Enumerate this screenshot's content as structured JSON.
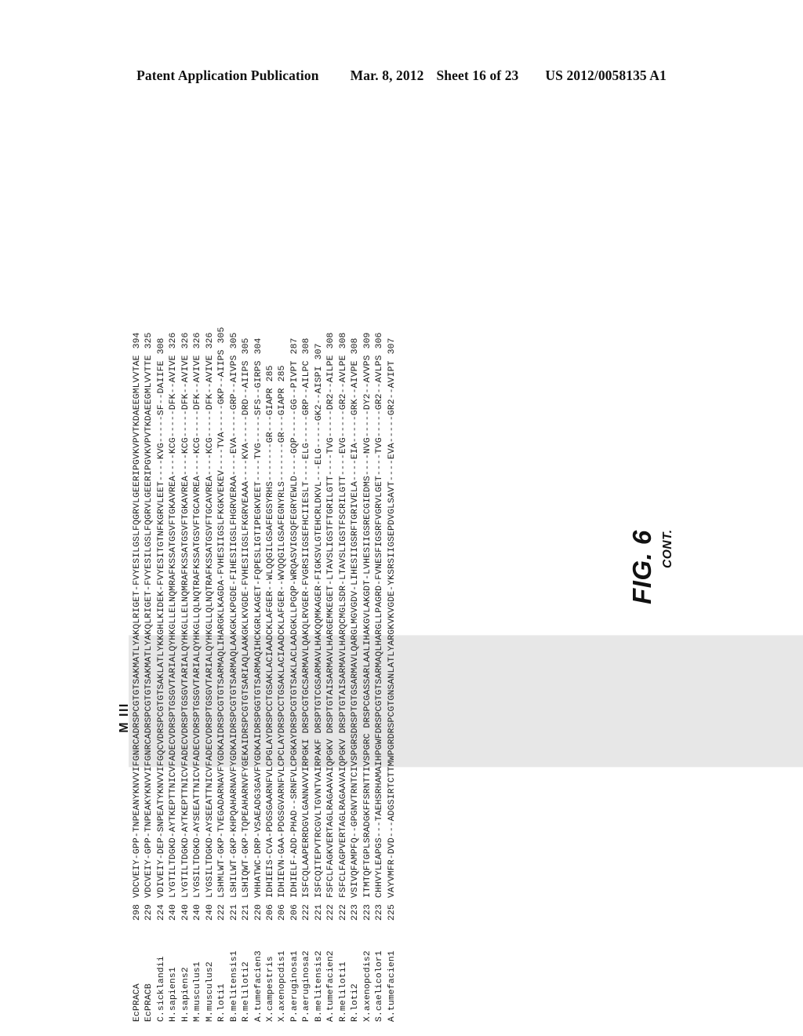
{
  "header": {
    "publication": "Patent Application Publication",
    "date": "Mar. 8, 2012",
    "sheet": "Sheet 16 of 23",
    "patent_number": "US 2012/0058135 A1"
  },
  "figure": {
    "caption_main": "FIG. 6",
    "caption_cont": "CONT.",
    "motif_label": "M III"
  },
  "alignment": {
    "rows": [
      {
        "name": "EcPRACA",
        "start": "298",
        "seq": "VDCVEIY-GPP-TNPEANYKNVVIFGNRCADRSPCGTGTSAKMATLYAKQLRIGET-FVYESILGSLFQGRVLGEERIPGVKVPVTKDAEEGMLVVTAE",
        "end": "394"
      },
      {
        "name": "EcPRACB",
        "start": "229",
        "seq": "VDCVEIY-GPP-TNPEAKYKNVVIFGNRCADRSPCGTGTSAKMATLYAKQLRIGET-FVYESILGSLFQGRVLGEERIPGVKVPVTKDAEEGMLVVTTE",
        "end": "325"
      },
      {
        "name": "C.sicklandii",
        "start": "224",
        "seq": "VDIVEIY-DEP-SNPEATYKNVVIFGQCVDRSPCGTGTSAKLATLYKKGHLKIDEK-FVYESITGTNFKGRVLEET----KVG-----SF--DAIIFE",
        "end": "308"
      },
      {
        "name": "H.sapiens1",
        "start": "240",
        "seq": "LYGTILTDGKD-AYTKEPTTNICVFADECVDRSPTGSGVTARIALQYHKGLLELNQMRAFKSSATGSVFTGKAVREA----KCG-----DFK--AVIVE",
        "end": "326"
      },
      {
        "name": "H.sapiens2",
        "start": "240",
        "seq": "LYGTILTDGKD-AYTKEPTTNICVFADECVDRSPTGSGVTARIALQYHKGLLELNQMRAFKSSATGSVFTGKAVREA----KCG-----DFK--AVIVE",
        "end": "326"
      },
      {
        "name": "M.musculus1",
        "start": "240",
        "seq": "LYGSILTDGKD-AYSEEATTNICVFADECVDRSPTGSGVTARIALQYHKGLLQLNQTRAFKSSATGSVFTGCAVREA----KCG-----DFK--AVIVE",
        "end": "326"
      },
      {
        "name": "M.musculus2",
        "start": "240",
        "seq": "LYGSILTDGKD-AYSEEATTNICVFADECVDRSPTGSGVTARIALQYHKGLLQLNQTRAFKSSATGSVFTGCAVREA----KCG-----DFK--AVIVE",
        "end": "326"
      },
      {
        "name": "R.loti1",
        "start": "222",
        "seq": "LSHMLWT-GKP-TVEGADARNAVFYGDKAIDRSPCGTGTSARMAQLIHARGKLKAGDA-FVHESIIGSLFKGKVEKEV----TVA-----GKP--AIIPS",
        "end": "305"
      },
      {
        "name": "B.melitensis1",
        "start": "221",
        "seq": "LSHILWT-GKP-KHPQAHARNAVFYGDKAIDRSPCGTGTSARMAQLAAKGKLKPGDE-FIHESIIGSLFHGRVERAA----EVA-----GRP--AIVPS",
        "end": "305"
      },
      {
        "name": "R.meliloti2",
        "start": "221",
        "seq": "LSHIQWT-GKP-TQPEAHARNVFYGEKAIDRSPCGTGTSARIAQLAAKGKLKVGDE-FVHESIIGSLFKGRVEAAA----KVA-----DRD--AIIPS",
        "end": "305"
      },
      {
        "name": "A.tumefacien3",
        "start": "220",
        "seq": "VHHATWC-DRP-VSAEADG3GAVFYGDKAIDRSPGGTGTSARMAQIHCKGRLKAGET-FQPESLIGTIPEGKVEET----TVG-----SFS--GIRPS",
        "end": "304"
      },
      {
        "name": "X.campestris",
        "start": "206",
        "seq": "IDHIEIS-CVA-PDGSGAARNFVLCPGLAYDRSPCCTGSAKLACIAADCKLAFGER--WLQQGILGSAFEGSYRHS-------GR---GIAPR",
        "end": "285"
      },
      {
        "name": "X.axenopcdis1",
        "start": "206",
        "seq": "IDHIEVN-GAA-PDGSGVARNFVLCPCLAYDRSPCCTGSAKLACIAADCKLAFGER--WVQQGILGSAFEGNYRLS-------GR---GIAPR",
        "end": "285"
      },
      {
        "name": "P.aeruginosa1",
        "start": "206",
        "seq": "IDHIELF-ADD-PHAD--SRNFVLCPGKAYDRSPCGTGTSAKLACLAADGKLLPGQP-WRQASVIGSQFEGRYEWLD----GQP-----GG--PIVPT",
        "end": "287"
      },
      {
        "name": "P.aeruginosa2",
        "start": "222",
        "seq": "ISFCQLAAPERRDGVLGANNAVVIRPGKI DRSPCGTGCSARMAVLQAKQLRVGER-FVGRSIIGSEFHCIIESLT----ELG-----GRP--AILPC",
        "end": "308"
      },
      {
        "name": "B.melitensis2",
        "start": "221",
        "seq": "ISFCQITEPVTRCGVLTGVNTVAIRPAKF DRSPTGTCGSARMAVLHAKQQMKAGER-FIGKSVLGTEHCRLDKVL---ELG-----GK2--AISPI",
        "end": "307"
      },
      {
        "name": "A.tumefacien2",
        "start": "222",
        "seq": "FSFCLFAGKVERTAGLRAGAAVAIQPGKV DRSPTGTAISARMAVLHARGEMKEGET-LTAVSLIGSTFTGRILGTT----TVG-----DR2--AILPE",
        "end": "308"
      },
      {
        "name": "R.meliloti1",
        "start": "222",
        "seq": "FSFCLFAGPVERTAGLRAGAAVAIQPGKV DRSPTGTAISARMAVLHARQCMGLSDR-LTAVSLIGSTFSCRILGTT----EVG-----GR2--AVLPE",
        "end": "308"
      },
      {
        "name": "R.loti2",
        "start": "223",
        "seq": "VSIVQFAMPFQ--GPGNVTRNTCIVSPGRSDRSPTGTGSARMAVLQARGLMGVGDV-LIHESIIGSRFTGRIVELA----EIA-----GRK--AIVPE",
        "end": "308"
      },
      {
        "name": "X.axenopcdis2",
        "start": "223",
        "seq": "ITMTQFTGPLSRADGKFFSRNTTIVSPGRC DRSPCGASSARLAALIHAKGVLAKGDT-LVHESIIGSRECGIEDMS----NVG-----DY2--AVVPS",
        "end": "309"
      },
      {
        "name": "S.caelicolor1",
        "start": "223",
        "seq": "CHHVYLEAPGS---TAEHSRHAMAIHPGWFDRSPCGTGTSARMAQLHARGLLPAGRD-FVNESFIGSRFVGRVLGET----TVG-----GR2--AVLPS",
        "end": "306"
      },
      {
        "name": "A.tumefacien1",
        "start": "225",
        "seq": "VAYVMFR-DVD---ADGSIRTCTTMWPGRDRSPCGTGNSANLATLYARGKVKVGDE-YKSRSIIGSEPDVGLSAVT----EVA-----GR2--AVIPT",
        "end": "307"
      }
    ]
  }
}
